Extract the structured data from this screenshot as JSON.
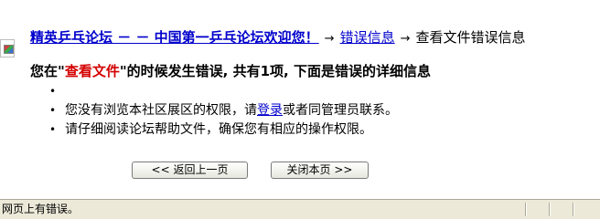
{
  "breadcrumb": {
    "forum_link": "精英乒乓论坛 － － 中国第一乒乓论坛欢迎您！",
    "arrow1": "→",
    "error_link": "错误信息",
    "arrow2": "→",
    "current": "查看文件错误信息"
  },
  "headline": {
    "prefix": "您在\"",
    "action": "查看文件",
    "suffix": "\"的时候发生错误, 共有1项, 下面是错误的详细信息"
  },
  "reasons": {
    "bullet": "•",
    "item1": "",
    "item2_before": "您没有浏览本社区展区的权限，请",
    "item2_link": "登录",
    "item2_after": "或者同管理员联系。",
    "item3": "请仔细阅读论坛帮助文件，确保您有相应的操作权限。"
  },
  "buttons": {
    "back": "<< 返回上一页",
    "close": "关闭本页 >>"
  },
  "statusbar": {
    "text": "网页上有错误。"
  },
  "colors": {
    "link": "#0000cc",
    "highlight": "#d40000",
    "statusbar_bg": "#ece9d8"
  }
}
